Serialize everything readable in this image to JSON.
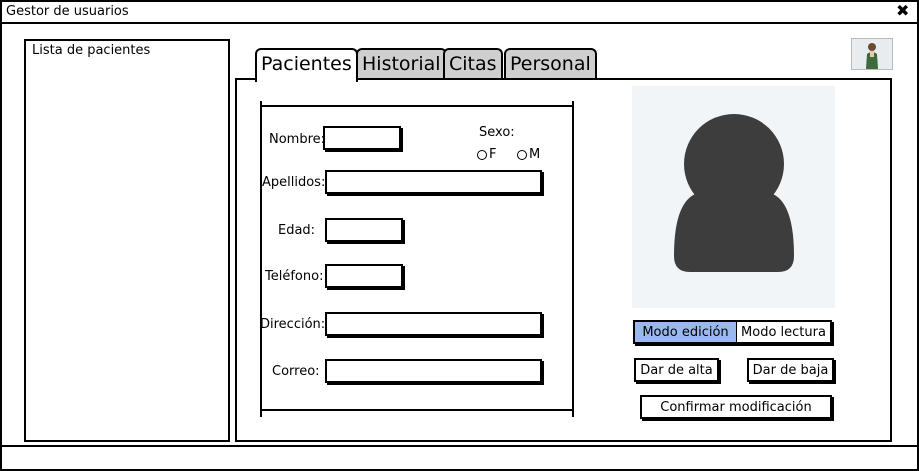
{
  "window": {
    "title": "Gestor de usuarios",
    "close_icon": "close-icon"
  },
  "sidebar": {
    "label": "Lista de pacientes"
  },
  "tabs": [
    {
      "label": "Pacientes",
      "active": true
    },
    {
      "label": "Historial",
      "active": false
    },
    {
      "label": "Citas",
      "active": false
    },
    {
      "label": "Personal",
      "active": false
    }
  ],
  "form": {
    "nombre": {
      "label": "Nombre:",
      "value": ""
    },
    "apellidos": {
      "label": "Apellidos:",
      "value": ""
    },
    "edad": {
      "label": "Edad:",
      "value": ""
    },
    "telefono": {
      "label": "Teléfono:",
      "value": ""
    },
    "direccion": {
      "label": "Dirección:",
      "value": ""
    },
    "correo": {
      "label": "Correo:",
      "value": ""
    },
    "sexo": {
      "label": "Sexo:",
      "options": [
        "F",
        "M"
      ]
    }
  },
  "photo": {
    "icon": "user-silhouette-icon"
  },
  "mode_toggle": {
    "edit_label": "Modo edición",
    "read_label": "Modo lectura",
    "selected": "edit"
  },
  "actions": {
    "alta_label": "Dar de alta",
    "baja_label": "Dar de baja",
    "confirm_label": "Confirmar modificación"
  },
  "colors": {
    "selected_button": "#9ab8ef",
    "photo_background": "#f2f5f8",
    "silhouette": "#3d3d3d"
  }
}
